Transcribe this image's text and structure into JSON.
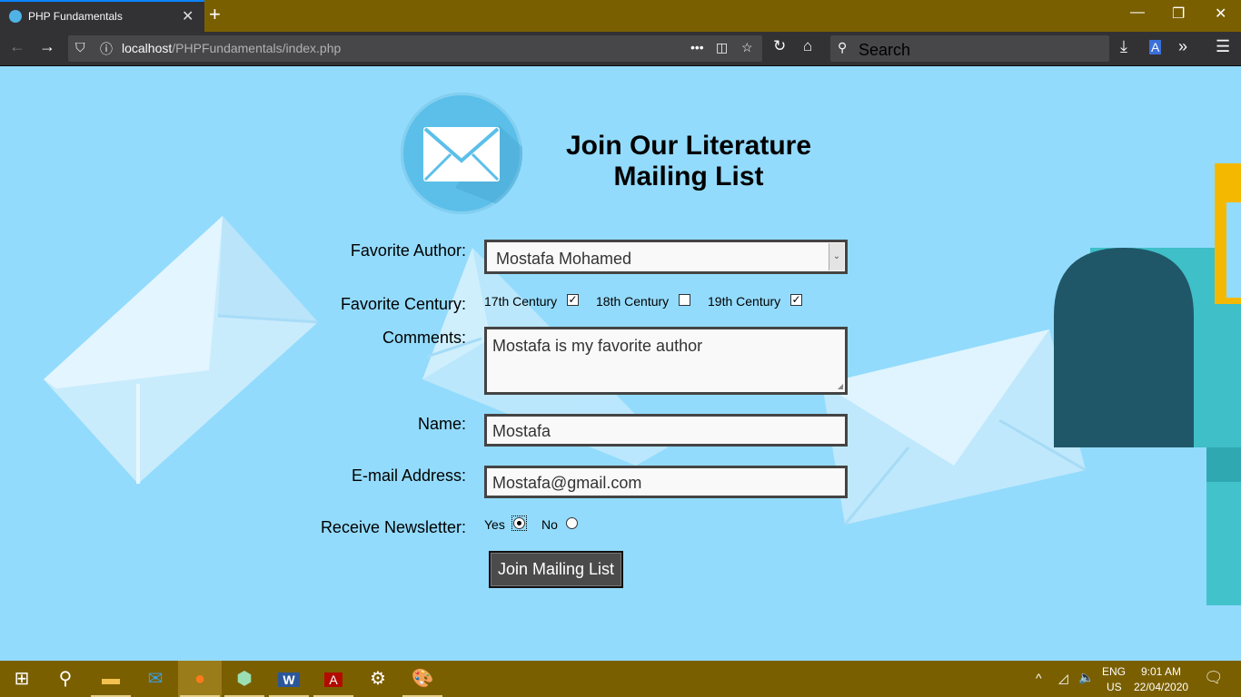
{
  "browser": {
    "tab_title": "PHP Fundamentals",
    "url_host": "localhost",
    "url_path": "/PHPFundamentals/index.php",
    "search_placeholder": "Search",
    "overflow": "•••"
  },
  "page": {
    "heading_line1": "Join Our Literature",
    "heading_line2": "Mailing List",
    "labels": {
      "author": "Favorite Author:",
      "century": "Favorite Century:",
      "comments": "Comments:",
      "name": "Name:",
      "email": "E-mail Address:",
      "newsletter": "Receive Newsletter:"
    },
    "author_selected": "Mostafa Mohamed",
    "centuries": [
      {
        "label": "17th Century",
        "checked": true
      },
      {
        "label": "18th Century",
        "checked": false
      },
      {
        "label": "19th Century",
        "checked": true
      }
    ],
    "comments_value": "Mostafa is my favorite author",
    "name_value": "Mostafa",
    "email_value": "Mostafa@gmail.com",
    "newsletter_yes": "Yes",
    "newsletter_no": "No",
    "newsletter_selected": "Yes",
    "submit_label": "Join Mailing List"
  },
  "taskbar": {
    "lang_line1": "ENG",
    "lang_line2": "US",
    "time": "9:01 AM",
    "date": "22/04/2020",
    "items": [
      "start-icon",
      "search-icon",
      "file-explorer-icon",
      "mail-icon",
      "firefox-icon",
      "app-cube-icon",
      "word-icon",
      "acrobat-icon",
      "settings-icon",
      "paint-icon"
    ]
  },
  "colors": {
    "page_bg": "#93dbfc",
    "chrome_bg": "#7a5f00",
    "toolbar_bg": "#323234"
  }
}
